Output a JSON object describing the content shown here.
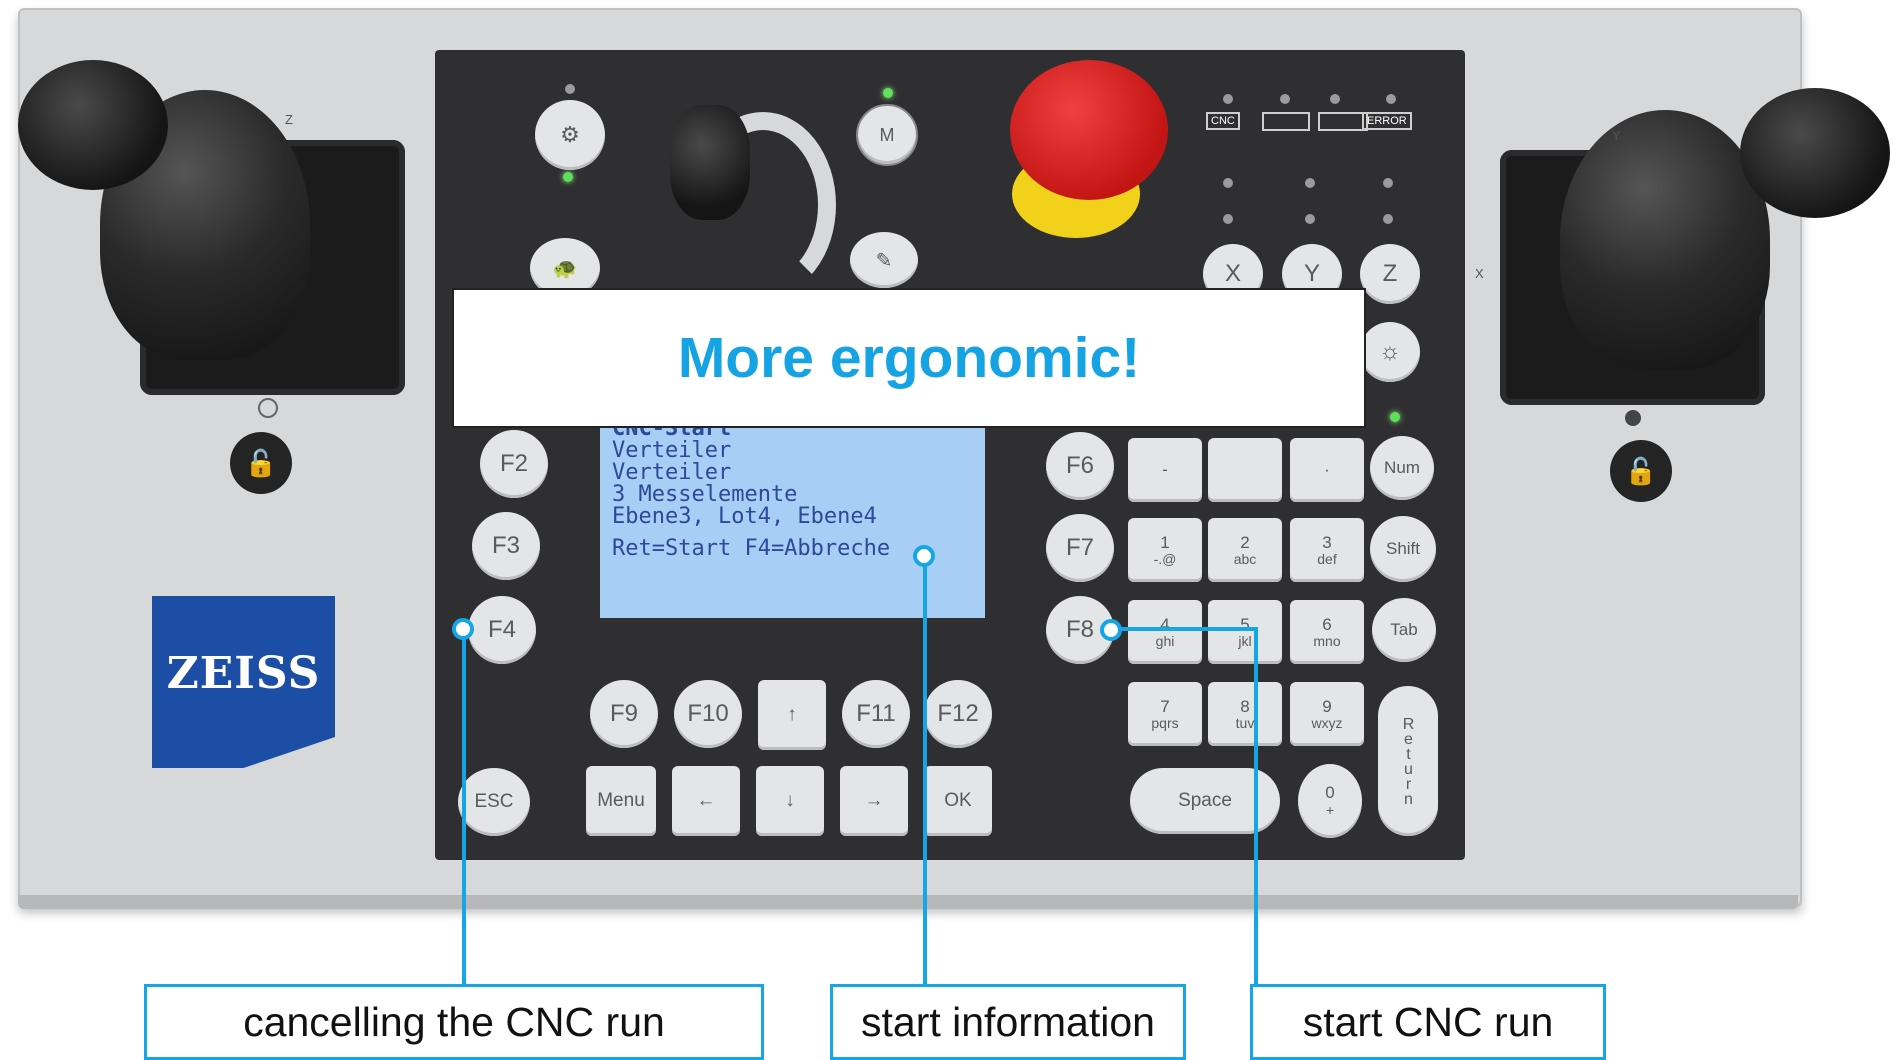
{
  "lcd": {
    "lines": [
      "CNC-Start",
      "Verteiler",
      "Verteiler",
      "3 Messelemente",
      "Ebene3, Lot4, Ebene4",
      "",
      "Ret=Start F4=Abbreche"
    ]
  },
  "banner": {
    "text": "More ergonomic!"
  },
  "callouts": {
    "cancel": "cancelling the CNC run",
    "info": "start information",
    "start": "start CNC run"
  },
  "logo": {
    "text": "ZEISS"
  },
  "status_labels": {
    "cnc": "CNC",
    "error": "ERROR"
  },
  "joystick_labels": {
    "left_axis": "Z",
    "right_axis_top": "Y",
    "right_axis_side": "X"
  },
  "keys": {
    "f_left": [
      "F2",
      "F3",
      "F4"
    ],
    "f_right": [
      "F6",
      "F7",
      "F8"
    ],
    "f_bottom": [
      "F9",
      "F10",
      "F11",
      "F12"
    ],
    "arrow_up": "↑",
    "esc": "ESC",
    "menu": "Menu",
    "left": "←",
    "down": "↓",
    "right": "→",
    "ok": "OK",
    "minus": "-",
    "blank": "",
    "dot": "·",
    "num": "Num",
    "shift": "Shift",
    "tab": "Tab",
    "return": "Return",
    "space": "Space",
    "m": "M",
    "axes": [
      "X",
      "Y",
      "Z"
    ],
    "numpad": [
      {
        "d": "1",
        "s": "-.@"
      },
      {
        "d": "2",
        "s": "abc"
      },
      {
        "d": "3",
        "s": "def"
      },
      {
        "d": "4",
        "s": "ghi"
      },
      {
        "d": "5",
        "s": "jkl"
      },
      {
        "d": "6",
        "s": "mno"
      },
      {
        "d": "7",
        "s": "pqrs"
      },
      {
        "d": "8",
        "s": "tuv"
      },
      {
        "d": "9",
        "s": "wxyz"
      },
      {
        "d": "0",
        "s": "+"
      }
    ]
  }
}
